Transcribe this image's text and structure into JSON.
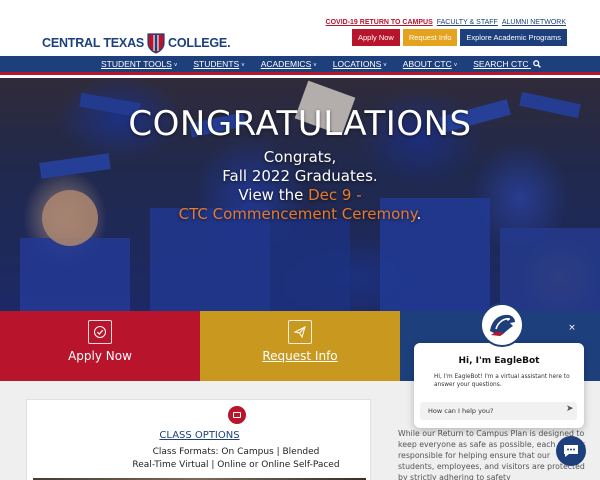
{
  "brand": {
    "name_left": "CENTRAL TEXAS",
    "name_right": "COLLEGE.",
    "colors": {
      "navy": "#1d3f7c",
      "red": "#b8142c",
      "gold": "#c8981f"
    }
  },
  "top_links": {
    "covid": "COVID-19 RETURN TO CAMPUS",
    "faculty": "FACULTY & STAFF",
    "alumni": "ALUMNI NETWORK"
  },
  "top_buttons": {
    "apply": "Apply Now",
    "request": "Request Info",
    "explore": "Explore Academic Programs"
  },
  "nav": [
    {
      "label": "STUDENT TOOLS"
    },
    {
      "label": "STUDENTS"
    },
    {
      "label": "ACADEMICS"
    },
    {
      "label": "LOCATIONS"
    },
    {
      "label": "ABOUT CTC"
    },
    {
      "label": "SEARCH CTC"
    }
  ],
  "hero": {
    "title": "CONGRATULATIONS",
    "line1": "Congrats,",
    "line2": "Fall 2022 Graduates.",
    "line3_prefix": "View the ",
    "line3_link": "Dec 9 -",
    "line4_link": "CTC Commencement Ceremony",
    "line4_suffix": "."
  },
  "cta": {
    "apply": {
      "label": "Apply Now",
      "icon": "check-icon"
    },
    "request": {
      "label": "Request Info",
      "icon": "paper-plane-icon"
    }
  },
  "card": {
    "icon": "calendar-icon",
    "link": "CLASS OPTIONS",
    "line1": "Class Formats: On Campus | Blended",
    "line2": "Real-Time Virtual | Online or Online Self-Paced"
  },
  "side_text": "While our Return to Campus Plan is designed to keep everyone as safe as possible, each of us is responsible for helping ensure that our students, employees, and visitors are protected by strictly adhering to safety",
  "chat": {
    "title": "Hi, I'm EagleBot",
    "message": "Hi, I'm EagleBot! I'm a virtual assistant here to answer your questions.",
    "placeholder": "How can I help you?",
    "close": "×"
  }
}
